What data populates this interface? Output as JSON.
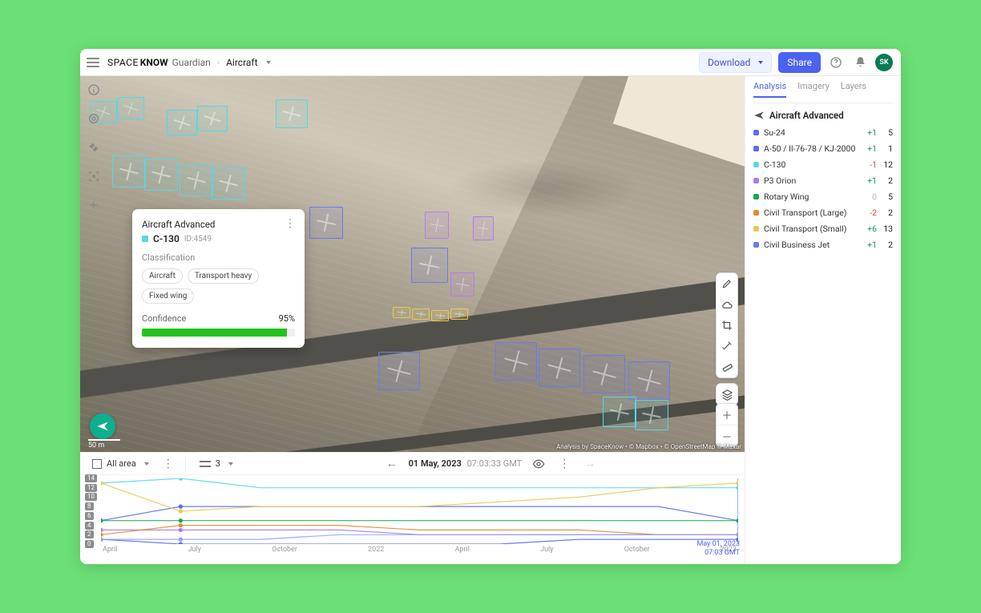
{
  "header": {
    "brand_prefix": "SPACE",
    "brand_bold": "KNOW",
    "brand_suffix": "Guardian",
    "breadcrumb": "Aircraft",
    "download": "Download",
    "share": "Share",
    "avatar": "SK"
  },
  "card": {
    "title": "Aircraft Advanced",
    "type": "C-130",
    "type_color": "#59d6e6",
    "id": "ID:4549",
    "class_label": "Classification",
    "tags": [
      "Aircraft",
      "Transport heavy",
      "Fixed wing"
    ],
    "conf_label": "Confidence",
    "conf_value": "95%",
    "conf_pct": 95
  },
  "map": {
    "scale": "50 m",
    "attribution": "Analysis by SpaceKnow • © Mapbox • © OpenStreetMap © Maxar"
  },
  "panel": {
    "tabs": [
      "Analysis",
      "Imagery",
      "Layers"
    ],
    "active_tab": 0,
    "title": "Aircraft Advanced",
    "items": [
      {
        "color": "#5b6cf0",
        "name": "Su-24",
        "delta": "+1",
        "delta_cls": "pos",
        "count": "5"
      },
      {
        "color": "#5b6cf0",
        "name": "A-50 / Il-76-78 / KJ-2000",
        "delta": "+1",
        "delta_cls": "pos",
        "count": "1"
      },
      {
        "color": "#59d6e6",
        "name": "C-130",
        "delta": "-1",
        "delta_cls": "neg",
        "count": "12"
      },
      {
        "color": "#a87be8",
        "name": "P3 Orion",
        "delta": "+1",
        "delta_cls": "pos",
        "count": "2"
      },
      {
        "color": "#17a84e",
        "name": "Rotary Wing",
        "delta": "0",
        "delta_cls": "muted",
        "count": "5"
      },
      {
        "color": "#e38a2d",
        "name": "Civil Transport (Large)",
        "delta": "-2",
        "delta_cls": "neg",
        "count": "2"
      },
      {
        "color": "#e8c94f",
        "name": "Civil Transport (Small)",
        "delta": "+6",
        "delta_cls": "pos",
        "count": "13"
      },
      {
        "color": "#6b7be8",
        "name": "Civil Business Jet",
        "delta": "+1",
        "delta_cls": "pos",
        "count": "2"
      }
    ]
  },
  "timeline": {
    "area": "All area",
    "num": "3",
    "date": "01 May, 2023",
    "time": "07:03:33 GMT",
    "flag_line1": "May 01, 2023",
    "flag_line2": "07:03 GMT"
  },
  "chart_data": {
    "type": "line",
    "xlabel": "",
    "ylabel": "",
    "ylim": [
      0,
      14
    ],
    "yticks": [
      14,
      12,
      10,
      8,
      6,
      4,
      2,
      0
    ],
    "x_labels": [
      "April",
      "July",
      "October",
      "2022",
      "April",
      "July",
      "October",
      "2023"
    ],
    "x": [
      0,
      1,
      2,
      3,
      4,
      5,
      6,
      7,
      8
    ],
    "series": [
      {
        "name": "Su-24",
        "color": "#5b6cf0",
        "values": [
          5,
          8,
          8,
          8,
          8,
          8,
          8,
          8,
          5
        ]
      },
      {
        "name": "A-50 / Il-76-78 / KJ-2000",
        "color": "#5b6cf0",
        "values": [
          1,
          0,
          0,
          0,
          0,
          0,
          1,
          1,
          1
        ]
      },
      {
        "name": "C-130",
        "color": "#59d6e6",
        "values": [
          13,
          14,
          12,
          12,
          12,
          12,
          12,
          12,
          12
        ]
      },
      {
        "name": "P3 Orion",
        "color": "#a87be8",
        "values": [
          3,
          3,
          3,
          3,
          2,
          2,
          2,
          2,
          2
        ]
      },
      {
        "name": "Rotary Wing",
        "color": "#17a84e",
        "values": [
          5,
          5,
          5,
          5,
          5,
          5,
          5,
          5,
          5
        ]
      },
      {
        "name": "Civil Transport (Large)",
        "color": "#e38a2d",
        "values": [
          2,
          4,
          4,
          4,
          3,
          3,
          3,
          2,
          2
        ]
      },
      {
        "name": "Civil Transport (Small)",
        "color": "#e8c94f",
        "values": [
          13,
          7,
          8,
          8,
          8,
          9,
          10,
          12,
          13
        ]
      },
      {
        "name": "Civil Business Jet",
        "color": "#8fa2ff",
        "values": [
          1,
          1,
          1,
          2,
          2,
          2,
          2,
          2,
          2
        ]
      }
    ]
  },
  "boxes": [
    {
      "cls": "t-cyan",
      "l": 12,
      "t": 31,
      "w": 34,
      "h": 28,
      "r": 20
    },
    {
      "cls": "t-cyan",
      "l": 46,
      "t": 26,
      "w": 34,
      "h": 28,
      "r": 20
    },
    {
      "cls": "t-cyan",
      "l": 108,
      "t": 42,
      "w": 38,
      "h": 32,
      "r": 18
    },
    {
      "cls": "t-cyan",
      "l": 146,
      "t": 37,
      "w": 38,
      "h": 32,
      "r": 18
    },
    {
      "cls": "t-cyan",
      "l": 244,
      "t": 29,
      "w": 40,
      "h": 36,
      "r": 15
    },
    {
      "cls": "t-cyan",
      "l": 40,
      "t": 99,
      "w": 42,
      "h": 40,
      "r": 14
    },
    {
      "cls": "t-cyan",
      "l": 80,
      "t": 103,
      "w": 42,
      "h": 40,
      "r": 14
    },
    {
      "cls": "t-cyan",
      "l": 124,
      "t": 110,
      "w": 42,
      "h": 40,
      "r": 14
    },
    {
      "cls": "t-cyan",
      "l": 164,
      "t": 114,
      "w": 42,
      "h": 40,
      "r": 14
    },
    {
      "cls": "t-blue",
      "l": 286,
      "t": 163,
      "w": 42,
      "h": 40,
      "r": 12
    },
    {
      "cls": "t-purple",
      "l": 430,
      "t": 169,
      "w": 30,
      "h": 34,
      "r": 10
    },
    {
      "cls": "t-purple",
      "l": 490,
      "t": 175,
      "w": 26,
      "h": 30,
      "r": 10
    },
    {
      "cls": "t-blue",
      "l": 413,
      "t": 214,
      "w": 46,
      "h": 44,
      "r": 12
    },
    {
      "cls": "t-purple",
      "l": 462,
      "t": 245,
      "w": 30,
      "h": 30,
      "r": 10
    },
    {
      "cls": "t-yellow",
      "l": 390,
      "t": 288,
      "w": 22,
      "h": 14,
      "r": 8
    },
    {
      "cls": "t-yellow",
      "l": 414,
      "t": 290,
      "w": 22,
      "h": 14,
      "r": 8
    },
    {
      "cls": "t-yellow",
      "l": 438,
      "t": 292,
      "w": 22,
      "h": 14,
      "r": 8
    },
    {
      "cls": "t-yellow",
      "l": 462,
      "t": 290,
      "w": 22,
      "h": 14,
      "r": 8
    },
    {
      "cls": "t-blue",
      "l": 372,
      "t": 344,
      "w": 52,
      "h": 48,
      "r": 15
    },
    {
      "cls": "t-blue",
      "l": 518,
      "t": 332,
      "w": 52,
      "h": 48,
      "r": 15
    },
    {
      "cls": "t-blue",
      "l": 572,
      "t": 340,
      "w": 52,
      "h": 48,
      "r": 15
    },
    {
      "cls": "t-blue",
      "l": 628,
      "t": 348,
      "w": 52,
      "h": 48,
      "r": 15
    },
    {
      "cls": "t-blue",
      "l": 684,
      "t": 356,
      "w": 52,
      "h": 48,
      "r": 15
    },
    {
      "cls": "t-cyan",
      "l": 652,
      "t": 400,
      "w": 42,
      "h": 38,
      "r": 12
    },
    {
      "cls": "t-cyan",
      "l": 692,
      "t": 404,
      "w": 42,
      "h": 38,
      "r": 12
    }
  ]
}
